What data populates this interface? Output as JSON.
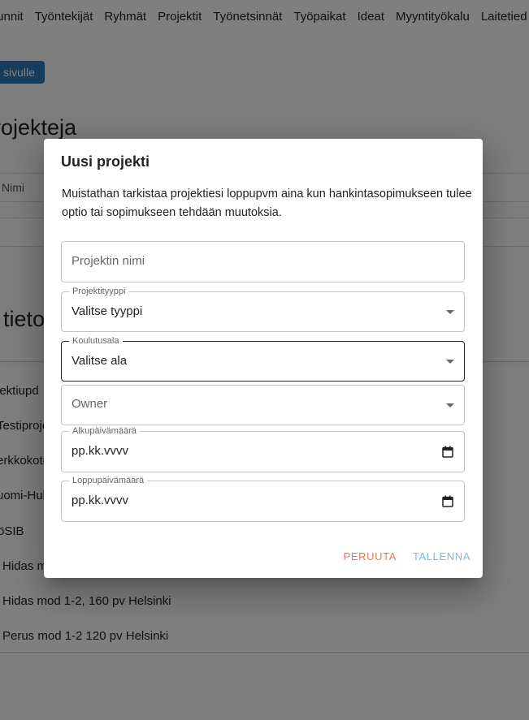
{
  "nav": {
    "items": [
      "tunnit",
      "Työntekijät",
      "Ryhmät",
      "Projektit",
      "Työnetsinnät",
      "Työpaikat",
      "Ideat",
      "Myyntityökalu",
      "Laitetied"
    ]
  },
  "page": {
    "back_label": "sivulle",
    "heading": "rojekteja",
    "table_col_name": "Nimi",
    "section_heading": "tieto",
    "projects": [
      "jektiupd",
      "Testiproje",
      "erkkokote",
      "uomi-Hub",
      "öSIB",
      "Hidas m",
      "Hidas mod 1-2, 160 pv Helsinki",
      "Perus mod 1-2 120 pv Helsinki"
    ]
  },
  "dialog": {
    "title": "Uusi projekti",
    "info": "Muistathan tarkistaa projektiesi loppupvm aina kun hankintasopimukseen tulee optio tai sopimukseen tehdään muutoksia.",
    "project_name_placeholder": "Projektin nimi",
    "project_type_label": "Projektityyppi",
    "project_type_value": "Valitse tyyppi",
    "field_label": "Koulutusala",
    "field_value": "Valitse ala",
    "owner_placeholder": "Owner",
    "start_label": "Alkupäivämäärä",
    "start_value": "pp.kk.vvvv",
    "end_label": "Loppupäivämäärä",
    "end_value": "pp.kk.vvvv",
    "cancel_label": "PERUUTA",
    "save_label": "TALLENNA"
  },
  "colors": {
    "back_button": "#2f79b8",
    "cancel": "#e8735a",
    "save": "#7fb8e3"
  }
}
